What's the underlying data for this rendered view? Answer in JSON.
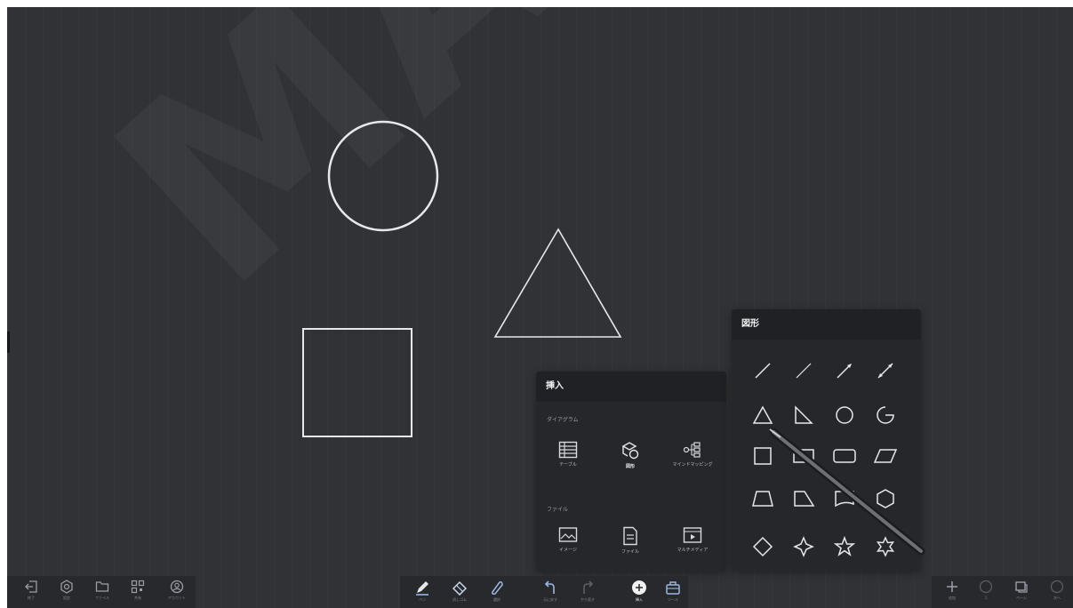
{
  "watermark": "MAYA S",
  "colors": {
    "canvas_bg": "#303236",
    "panel_bg": "#25272b",
    "stroke": "#e6e8ea",
    "accent_blue": "#9cb8e0"
  },
  "insert_panel": {
    "title": "挿入",
    "diagram_section": "ダイアグラム",
    "items_diagram": [
      {
        "icon": "table-icon",
        "label": "テーブル"
      },
      {
        "icon": "shapes-icon",
        "label": "図形"
      },
      {
        "icon": "mindmap-icon",
        "label": "マインドマッピング"
      }
    ],
    "file_section": "ファイル",
    "items_file": [
      {
        "icon": "image-icon",
        "label": "イメージ"
      },
      {
        "icon": "file-icon",
        "label": "ファイル"
      },
      {
        "icon": "multimedia-icon",
        "label": "マルチメディア"
      }
    ]
  },
  "shapes_panel": {
    "title": "図形",
    "rows": [
      [
        "line-icon",
        "dashed-line-icon",
        "arrow-line-icon",
        "double-arrow-line-icon"
      ],
      [
        "triangle-icon",
        "right-triangle-icon",
        "circle-icon",
        "arc-icon"
      ],
      [
        "square-icon",
        "rectangle-icon",
        "rounded-rectangle-icon",
        "parallelogram-icon"
      ],
      [
        "trapezoid-icon",
        "right-trapezoid-icon",
        "document-shape-icon",
        "hexagon-icon"
      ],
      [
        "diamond-icon",
        "four-point-star-icon",
        "five-point-star-icon",
        "six-point-star-icon"
      ]
    ]
  },
  "toolbar_left": [
    {
      "icon": "exit-icon",
      "label": "終了"
    },
    {
      "icon": "settings-icon",
      "label": "設定"
    },
    {
      "icon": "folder-icon",
      "label": "ファイル"
    },
    {
      "icon": "qr-code-icon",
      "label": "共有"
    },
    {
      "icon": "account-icon",
      "label": "アカウント"
    }
  ],
  "toolbar_center": [
    {
      "icon": "pen-icon",
      "label": "ペン"
    },
    {
      "icon": "eraser-icon",
      "label": "消しゴム"
    },
    {
      "icon": "select-icon",
      "label": "選択"
    },
    {
      "icon": "undo-icon",
      "label": "元に戻す"
    },
    {
      "icon": "redo-icon",
      "label": "やり直す"
    },
    {
      "icon": "insert-icon",
      "label": "挿入"
    },
    {
      "icon": "toolbox-icon",
      "label": "ツール"
    }
  ],
  "toolbar_right": [
    {
      "icon": "add-page-icon",
      "label": "追加"
    },
    {
      "icon": "page-counter-icon",
      "label": "1"
    },
    {
      "icon": "pages-icon",
      "label": "ページ"
    },
    {
      "icon": "next-page-icon",
      "label": "次へ"
    }
  ]
}
